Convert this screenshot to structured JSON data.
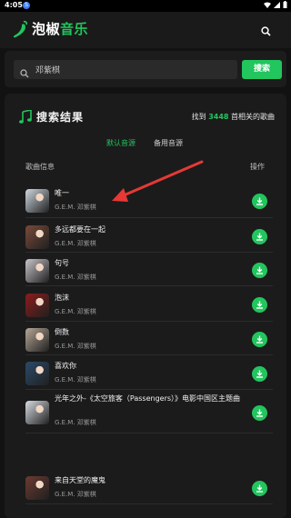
{
  "status_bar": {
    "time": "4:05",
    "notification": "S"
  },
  "app": {
    "brand_part1": "泡椒",
    "brand_part2": "音乐"
  },
  "search": {
    "value": "邓紫棋",
    "button_label": "搜索"
  },
  "results": {
    "title": "搜索结果",
    "count_prefix": "找到",
    "count": "3448",
    "count_suffix": "首相关的歌曲",
    "tabs": [
      "默认音源",
      "备用音源"
    ],
    "col_info": "歌曲信息",
    "col_action": "操作",
    "songs": [
      {
        "title": "唯一",
        "artist": "G.E.M. 邓紫棋",
        "cover": "#cfd8e0"
      },
      {
        "title": "多远都要在一起",
        "artist": "G.E.M. 邓紫棋",
        "cover": "#7a4a3a"
      },
      {
        "title": "句号",
        "artist": "G.E.M. 邓紫棋",
        "cover": "#c9c4c9"
      },
      {
        "title": "泡沫",
        "artist": "G.E.M. 邓紫棋",
        "cover": "#8e1b1b"
      },
      {
        "title": "倒数",
        "artist": "G.E.M. 邓紫棋",
        "cover": "#b6a796"
      },
      {
        "title": "喜欢你",
        "artist": "G.E.M. 邓紫棋",
        "cover": "#2b4a6a"
      },
      {
        "title": "光年之外-《太空旅客（Passengers）》电影中国区主题曲",
        "artist": "G.E.M. 邓紫棋",
        "cover": "#d7dce2"
      },
      {
        "title": "来自天堂的魔鬼",
        "artist": "G.E.M. 邓紫棋",
        "cover": "#6b3b30"
      }
    ]
  },
  "colors": {
    "accent": "#22c55e",
    "annotation_arrow": "#e53935"
  }
}
